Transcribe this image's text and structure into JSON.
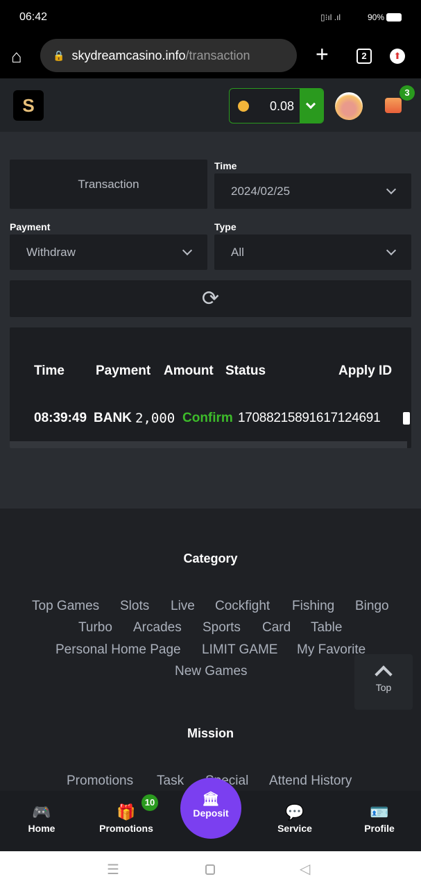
{
  "status_bar": {
    "time": "06:42",
    "battery": "90%"
  },
  "browser": {
    "url_domain": "skydreamcasino.info",
    "url_path": "/transaction",
    "tab_count": "2"
  },
  "header": {
    "balance": "0.08",
    "notification_count": "3"
  },
  "filters": {
    "tab_label": "Transaction",
    "time_label": "Time",
    "time_value": "2024/02/25",
    "payment_label": "Payment",
    "payment_value": "Withdraw",
    "type_label": "Type",
    "type_value": "All"
  },
  "table": {
    "headers": [
      "Time",
      "Payment",
      "Amount",
      "Status",
      "Apply ID"
    ],
    "rows": [
      {
        "time": "08:39:49",
        "payment": "BANK",
        "amount": "2,000",
        "status": "Confirm",
        "apply_id": "17088215891617124691"
      }
    ]
  },
  "footer": {
    "category_title": "Category",
    "categories": [
      "Top Games",
      "Slots",
      "Live",
      "Cockfight",
      "Fishing",
      "Bingo",
      "Turbo",
      "Arcades",
      "Sports",
      "Card",
      "Table",
      "Personal Home Page",
      "LIMIT GAME",
      "My Favorite",
      "New Games"
    ],
    "mission_title": "Mission",
    "missions": [
      "Promotions",
      "Task",
      "Special",
      "Attend History"
    ],
    "top_label": "Top"
  },
  "bottom_nav": {
    "home": "Home",
    "promotions": "Promotions",
    "promotions_badge": "10",
    "deposit": "Deposit",
    "service": "Service",
    "profile": "Profile"
  },
  "colors": {
    "accent_green": "#2a9a1e",
    "status_confirm": "#3dbb2a",
    "deposit_purple": "#7b3ff0"
  }
}
